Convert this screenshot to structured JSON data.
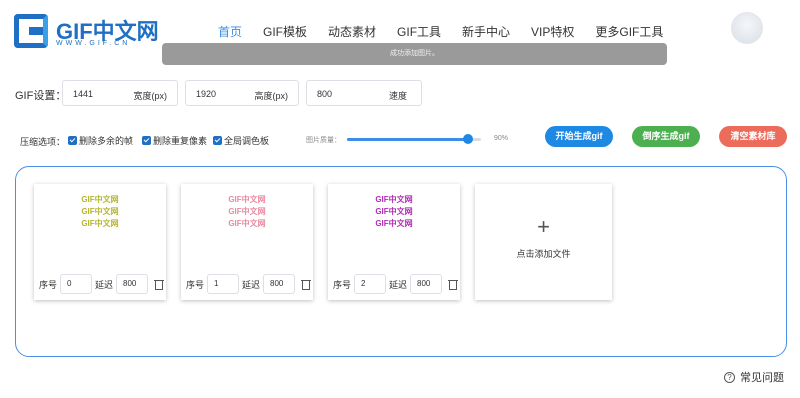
{
  "logo": {
    "text": "GIF中文网",
    "sub": "WWW.GIF.CN"
  },
  "nav": [
    {
      "label": "首页",
      "active": true
    },
    {
      "label": "GIF模板"
    },
    {
      "label": "动态素材"
    },
    {
      "label": "GIF工具"
    },
    {
      "label": "新手中心"
    },
    {
      "label": "VIP特权"
    },
    {
      "label": "更多GIF工具"
    }
  ],
  "toast": "成功添加图片。",
  "settings": {
    "label": "GIF设置：",
    "width": {
      "value": "1441",
      "unit": "宽度(px)"
    },
    "height": {
      "value": "1920",
      "unit": "高度(px)"
    },
    "speed": {
      "value": "800",
      "unit": "速度"
    }
  },
  "compression": {
    "label": "压缩选项：",
    "options": [
      "删除多余的帧",
      "删除重复像素",
      "全局调色板"
    ],
    "quality_label": "图片质量：",
    "quality_value": "90%",
    "quality_fraction": 0.9
  },
  "buttons": {
    "start": "开始生成gif",
    "reverse": "倒序生成gif",
    "clear": "清空素材库"
  },
  "frames": [
    {
      "seq_label": "序号",
      "seq": "0",
      "delay_label": "延迟",
      "delay": "800",
      "lines": [
        "GIF中文网",
        "GIF中文网",
        "GIF中文网"
      ],
      "color": "#b5b52e"
    },
    {
      "seq_label": "序号",
      "seq": "1",
      "delay_label": "延迟",
      "delay": "800",
      "lines": [
        "GIF中文网",
        "GIF中文网",
        "GIF中文网"
      ],
      "color": "#e88aa0"
    },
    {
      "seq_label": "序号",
      "seq": "2",
      "delay_label": "延迟",
      "delay": "800",
      "lines": [
        "GIF中文网",
        "GIF中文网",
        "GIF中文网"
      ],
      "color": "#b02bb8"
    }
  ],
  "add_file": {
    "plus": "+",
    "label": "点击添加文件"
  },
  "faq": "常见问题"
}
